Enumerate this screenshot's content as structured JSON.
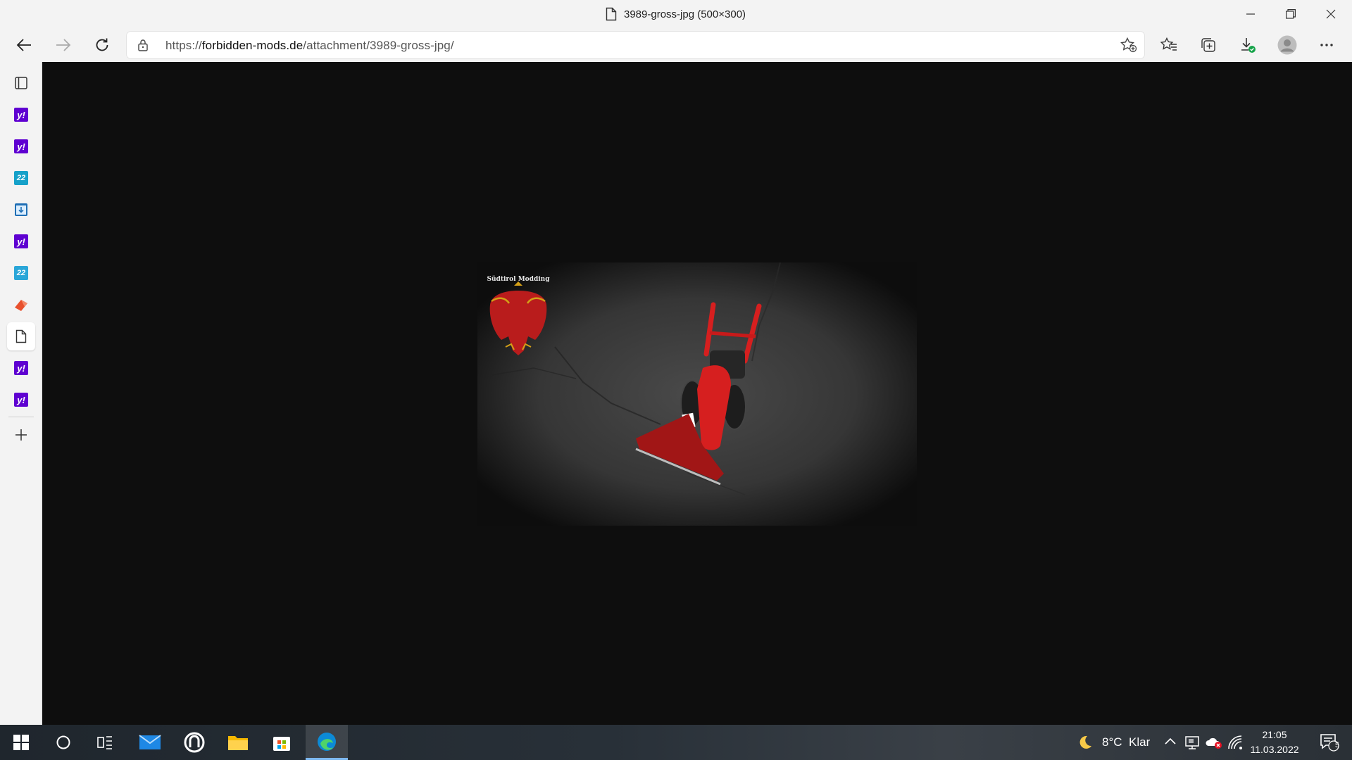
{
  "window": {
    "title": "3989-gross-jpg (500×300)"
  },
  "address_bar": {
    "url_prefix": "https://",
    "url_host": "forbidden-mods.de",
    "url_path": "/attachment/3989-gross-jpg/"
  },
  "sidebar": {
    "items": [
      {
        "icon": "tab-actions-icon"
      },
      {
        "icon": "yahoo-icon",
        "glyph": "y!"
      },
      {
        "icon": "yahoo-icon",
        "glyph": "y!"
      },
      {
        "icon": "app-22-icon",
        "glyph": "22"
      },
      {
        "icon": "download-app-icon"
      },
      {
        "icon": "yahoo-icon",
        "glyph": "y!"
      },
      {
        "icon": "app-22-icon",
        "glyph": "22"
      },
      {
        "icon": "office-icon"
      },
      {
        "icon": "document-icon"
      },
      {
        "icon": "yahoo-icon",
        "glyph": "y!"
      },
      {
        "icon": "yahoo-icon",
        "glyph": "y!"
      }
    ]
  },
  "image": {
    "logo_text": "Südtirol Modding"
  },
  "taskbar": {
    "weather_temp": "8°C",
    "weather_text": "Klar",
    "time": "21:05",
    "date": "11.03.2022",
    "notification_count": "5"
  },
  "colors": {
    "yahoo": "#5f01d1",
    "accent": "#0078d4",
    "content_bg": "#0e0e0e"
  }
}
